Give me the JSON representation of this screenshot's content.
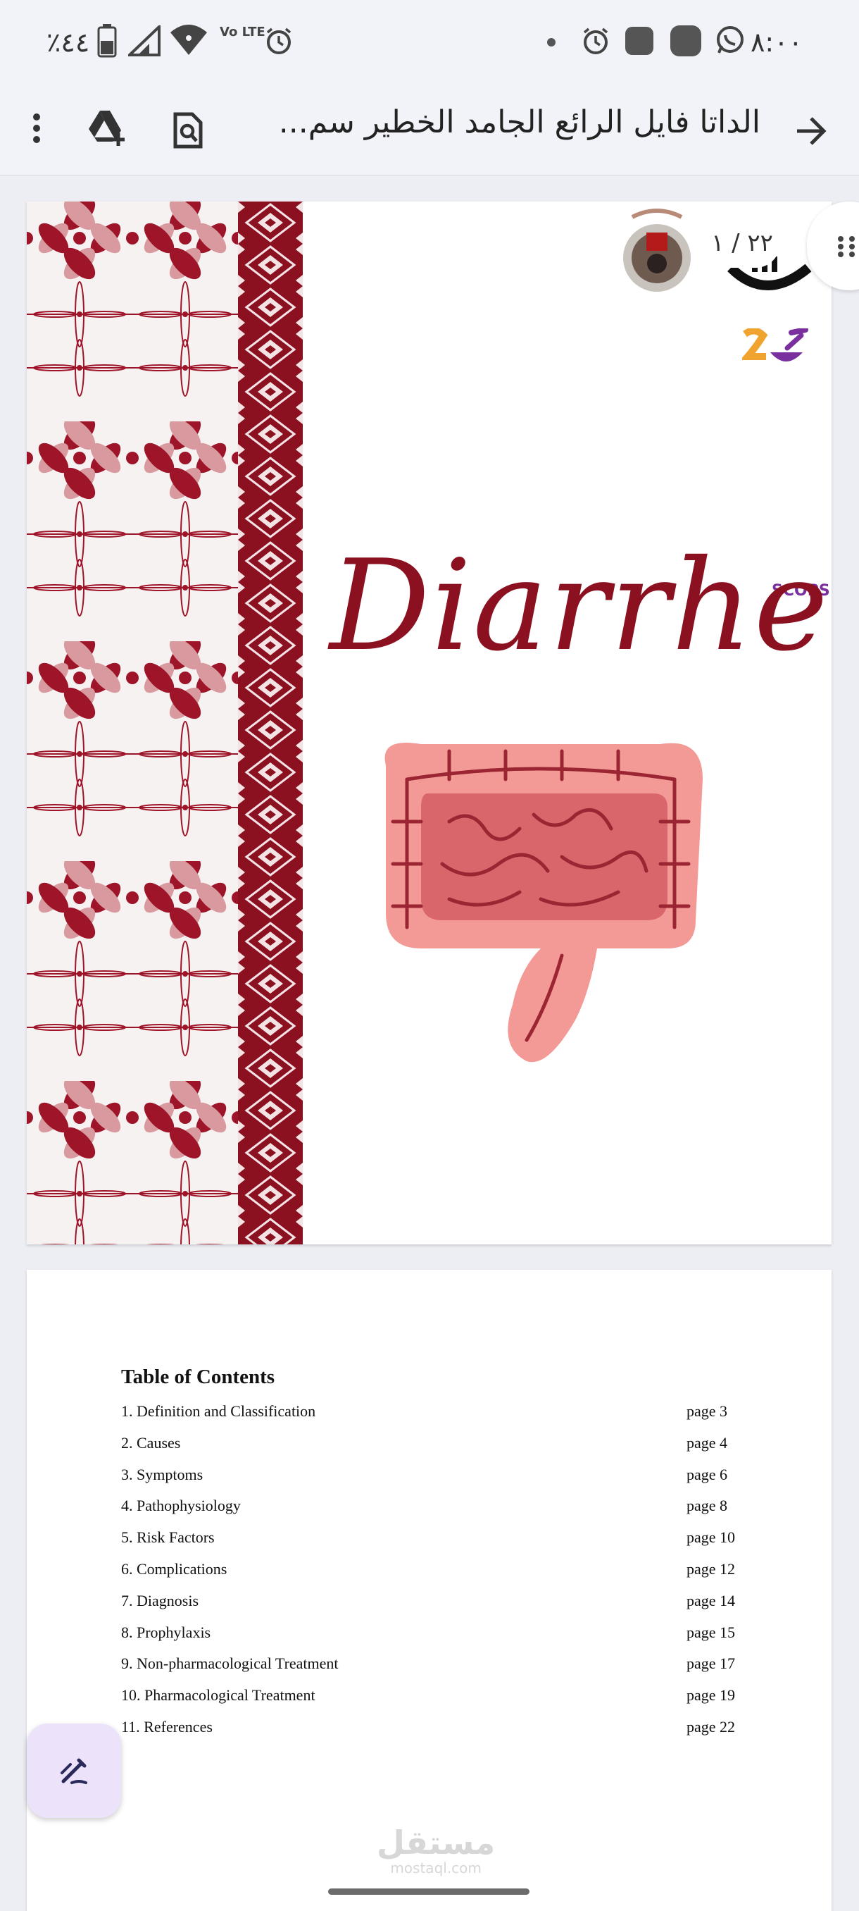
{
  "status_bar": {
    "time": "٨:٠٠",
    "battery": "٪٤٤",
    "network": "Vo LTE",
    "icons": [
      "battery-icon",
      "signal-icon",
      "wifi-icon",
      "volte-icon",
      "alarm-icon",
      "dot-icon",
      "alarm-icon",
      "app-icon",
      "app-icon",
      "whatsapp-icon"
    ]
  },
  "toolbar": {
    "title": "الداتا فايل الرائع الجامد الخطير سم...",
    "icons": [
      "back-arrow-icon",
      "find-in-page-icon",
      "add-to-drive-icon",
      "more-vert-icon"
    ]
  },
  "viewer": {
    "page_indicator": "٢٢ / ١"
  },
  "page1": {
    "title": "Diarrhea",
    "logo_text": "SCOPS",
    "accent": "#8b1020"
  },
  "toc": {
    "title": "Table of Contents",
    "items": [
      {
        "label": "1. Definition and Classification",
        "page": "page 3"
      },
      {
        "label": "2. Causes",
        "page": "page 4"
      },
      {
        "label": "3. Symptoms",
        "page": "page 6"
      },
      {
        "label": "4. Pathophysiology",
        "page": "page 8"
      },
      {
        "label": "5. Risk Factors",
        "page": "page 10"
      },
      {
        "label": "6. Complications",
        "page": "page 12"
      },
      {
        "label": "7. Diagnosis",
        "page": "page 14"
      },
      {
        "label": "8. Prophylaxis",
        "page": "page 15"
      },
      {
        "label": "9. Non-pharmacological Treatment",
        "page": "page 17"
      },
      {
        "label": "10. Pharmacological Treatment",
        "page": "page 19"
      },
      {
        "label": "11. References",
        "page": "page 22"
      }
    ]
  },
  "watermark": {
    "arabic": "مستقل",
    "latin": "mostaql.com"
  }
}
